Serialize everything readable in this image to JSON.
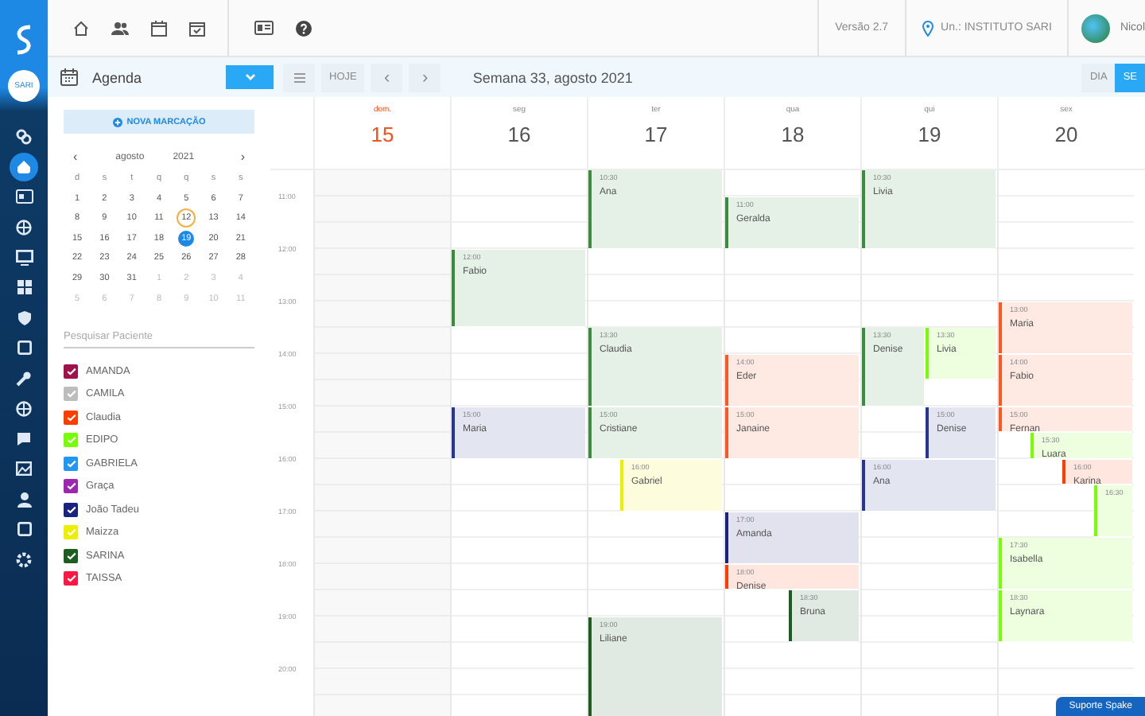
{
  "rail": [
    {
      "kind": "link",
      "selected": false
    },
    {
      "kind": "home",
      "selected": true
    },
    {
      "kind": "card",
      "selected": false
    },
    {
      "kind": "globe",
      "selected": false
    },
    {
      "kind": "monitor",
      "selected": false
    },
    {
      "kind": "grid",
      "selected": false
    },
    {
      "kind": "shield",
      "selected": false
    },
    {
      "kind": "box",
      "selected": false
    },
    {
      "kind": "wrench",
      "selected": false
    },
    {
      "kind": "globe",
      "selected": false
    },
    {
      "kind": "chat",
      "selected": false
    },
    {
      "kind": "image",
      "selected": false
    },
    {
      "kind": "user",
      "selected": false
    },
    {
      "kind": "box",
      "selected": false
    },
    {
      "kind": "gear",
      "selected": false
    }
  ],
  "rail_badge": "SARI",
  "topbar": {
    "version": "Versão 2.7",
    "unit": "Un.: INSTITUTO SARI",
    "user": "Nicol"
  },
  "toolbar": {
    "title": "Agenda",
    "today": "HOJE",
    "prev": "‹",
    "next": "›",
    "period": "Semana 33, agosto 2021",
    "views": [
      {
        "label": "DIA",
        "selected": false
      },
      {
        "label": "SE",
        "selected": true
      }
    ]
  },
  "new_button": "NOVA MARCAÇÃO",
  "mini_calendar": {
    "month": "agosto",
    "year": "2021",
    "prev": "‹",
    "next": "›",
    "weekdays": [
      "d",
      "s",
      "t",
      "q",
      "q",
      "s",
      "s"
    ],
    "weeks": [
      [
        {
          "d": "1",
          "outside": false,
          "today": false,
          "selected": false
        },
        {
          "d": "2",
          "outside": false,
          "today": false,
          "selected": false
        },
        {
          "d": "3",
          "outside": false,
          "today": false,
          "selected": false
        },
        {
          "d": "4",
          "outside": false,
          "today": false,
          "selected": false
        },
        {
          "d": "5",
          "outside": false,
          "today": false,
          "selected": false
        },
        {
          "d": "6",
          "outside": false,
          "today": false,
          "selected": false
        },
        {
          "d": "7",
          "outside": false,
          "today": false,
          "selected": false
        }
      ],
      [
        {
          "d": "8",
          "outside": false,
          "today": false,
          "selected": false
        },
        {
          "d": "9",
          "outside": false,
          "today": false,
          "selected": false
        },
        {
          "d": "10",
          "outside": false,
          "today": false,
          "selected": false
        },
        {
          "d": "11",
          "outside": false,
          "today": false,
          "selected": false
        },
        {
          "d": "12",
          "outside": false,
          "today": true,
          "selected": false
        },
        {
          "d": "13",
          "outside": false,
          "today": false,
          "selected": false
        },
        {
          "d": "14",
          "outside": false,
          "today": false,
          "selected": false
        }
      ],
      [
        {
          "d": "15",
          "outside": false,
          "today": false,
          "selected": false
        },
        {
          "d": "16",
          "outside": false,
          "today": false,
          "selected": false
        },
        {
          "d": "17",
          "outside": false,
          "today": false,
          "selected": false
        },
        {
          "d": "18",
          "outside": false,
          "today": false,
          "selected": false
        },
        {
          "d": "19",
          "outside": false,
          "today": false,
          "selected": true
        },
        {
          "d": "20",
          "outside": false,
          "today": false,
          "selected": false
        },
        {
          "d": "21",
          "outside": false,
          "today": false,
          "selected": false
        }
      ],
      [
        {
          "d": "22",
          "outside": false,
          "today": false,
          "selected": false
        },
        {
          "d": "23",
          "outside": false,
          "today": false,
          "selected": false
        },
        {
          "d": "24",
          "outside": false,
          "today": false,
          "selected": false
        },
        {
          "d": "25",
          "outside": false,
          "today": false,
          "selected": false
        },
        {
          "d": "26",
          "outside": false,
          "today": false,
          "selected": false
        },
        {
          "d": "27",
          "outside": false,
          "today": false,
          "selected": false
        },
        {
          "d": "28",
          "outside": false,
          "today": false,
          "selected": false
        }
      ],
      [
        {
          "d": "29",
          "outside": false,
          "today": false,
          "selected": false
        },
        {
          "d": "30",
          "outside": false,
          "today": false,
          "selected": false
        },
        {
          "d": "31",
          "outside": false,
          "today": false,
          "selected": false
        },
        {
          "d": "1",
          "outside": true,
          "today": false,
          "selected": false
        },
        {
          "d": "2",
          "outside": true,
          "today": false,
          "selected": false
        },
        {
          "d": "3",
          "outside": true,
          "today": false,
          "selected": false
        },
        {
          "d": "4",
          "outside": true,
          "today": false,
          "selected": false
        }
      ],
      [
        {
          "d": "5",
          "outside": true,
          "today": false,
          "selected": false
        },
        {
          "d": "6",
          "outside": true,
          "today": false,
          "selected": false
        },
        {
          "d": "7",
          "outside": true,
          "today": false,
          "selected": false
        },
        {
          "d": "8",
          "outside": true,
          "today": false,
          "selected": false
        },
        {
          "d": "9",
          "outside": true,
          "today": false,
          "selected": false
        },
        {
          "d": "10",
          "outside": true,
          "today": false,
          "selected": false
        },
        {
          "d": "11",
          "outside": true,
          "today": false,
          "selected": false
        }
      ]
    ]
  },
  "search": {
    "placeholder": "Pesquisar Paciente"
  },
  "patients": [
    {
      "name": "AMANDA",
      "checked": true,
      "color": "#a0134a"
    },
    {
      "name": "CAMILA",
      "checked": true,
      "color": "#bdbdbd"
    },
    {
      "name": "Claudia",
      "checked": true,
      "color": "#ff3d00"
    },
    {
      "name": "EDIPO",
      "checked": true,
      "color": "#76ff03"
    },
    {
      "name": "GABRIELA",
      "checked": true,
      "color": "#2196f3"
    },
    {
      "name": "Graça",
      "checked": true,
      "color": "#9c27b0"
    },
    {
      "name": "João Tadeu",
      "checked": true,
      "color": "#1a237e"
    },
    {
      "name": "Maizza",
      "checked": true,
      "color": "#eeee00"
    },
    {
      "name": "SARINA",
      "checked": true,
      "color": "#1b5e20"
    },
    {
      "name": "TAISSA",
      "checked": true,
      "color": "#ff1744"
    }
  ],
  "hours": [
    "11:00",
    "12:00",
    "13:00",
    "14:00",
    "15:00",
    "16:00",
    "17:00",
    "18:00",
    "19:00",
    "20:00"
  ],
  "days": [
    {
      "weekday": "dom.",
      "date": "15",
      "sunday": true
    },
    {
      "weekday": "seg",
      "date": "16",
      "sunday": false,
      "events": [
        {
          "time": "12:00",
          "name": "Fabio",
          "color": "#388e3c"
        },
        {
          "time": "15:00",
          "name": "Maria",
          "color": "#283593"
        }
      ]
    },
    {
      "weekday": "ter",
      "date": "17",
      "sunday": false,
      "events": [
        {
          "time": "10:30",
          "name": "Ana",
          "color": "#388e3c"
        },
        {
          "time": "13:30",
          "name": "Claudia",
          "color": "#388e3c"
        },
        {
          "time": "15:00",
          "name": "Cristiane",
          "color": "#388e3c"
        },
        {
          "time": "16:00",
          "name": "Gabriel",
          "color": "#eeee00"
        },
        {
          "time": "19:00",
          "name": "Liliane",
          "color": "#1b5e20"
        }
      ]
    },
    {
      "weekday": "qua",
      "date": "18",
      "sunday": false,
      "events": [
        {
          "time": "11:00",
          "name": "Geralda",
          "color": "#388e3c"
        },
        {
          "time": "14:00",
          "name": "Eder",
          "color": "#ff5722"
        },
        {
          "time": "15:00",
          "name": "Janaine",
          "color": "#ff5722"
        },
        {
          "time": "17:00",
          "name": "Amanda",
          "color": "#1a237e"
        },
        {
          "time": "18:00",
          "name": "Denise",
          "color": "#ff3d00"
        },
        {
          "time": "18:30",
          "name": "Bruna",
          "color": "#1b5e20"
        }
      ]
    },
    {
      "weekday": "qui",
      "date": "19",
      "sunday": false,
      "events": [
        {
          "time": "10:30",
          "name": "Livia",
          "color": "#388e3c"
        },
        {
          "time": "13:30",
          "name": "Denise",
          "color": "#388e3c"
        },
        {
          "time": "13:30",
          "name": "Livia",
          "color": "#76ff03"
        },
        {
          "time": "15:00",
          "name": "Denise",
          "color": "#283593"
        },
        {
          "time": "16:00",
          "name": "Ana",
          "color": "#283593"
        }
      ]
    },
    {
      "weekday": "sex",
      "date": "20",
      "sunday": false,
      "events": [
        {
          "time": "13:00",
          "name": "Maria",
          "color": "#ff5722"
        },
        {
          "time": "14:00",
          "name": "Fabio",
          "color": "#ff5722"
        },
        {
          "time": "15:00",
          "name": "Fernan",
          "color": "#ff5722"
        },
        {
          "time": "15:30",
          "name": "Luara",
          "color": "#76ff03"
        },
        {
          "time": "16:00",
          "name": "Karina",
          "color": "#ff3d00"
        },
        {
          "time": "16:30",
          "color": "#76ff03"
        },
        {
          "time": "17:30",
          "name": "Isabella",
          "color": "#76ff03"
        },
        {
          "time": "18:30",
          "name": "Laynara",
          "color": "#76ff03"
        }
      ]
    }
  ],
  "support_button": "Suporte Spake"
}
